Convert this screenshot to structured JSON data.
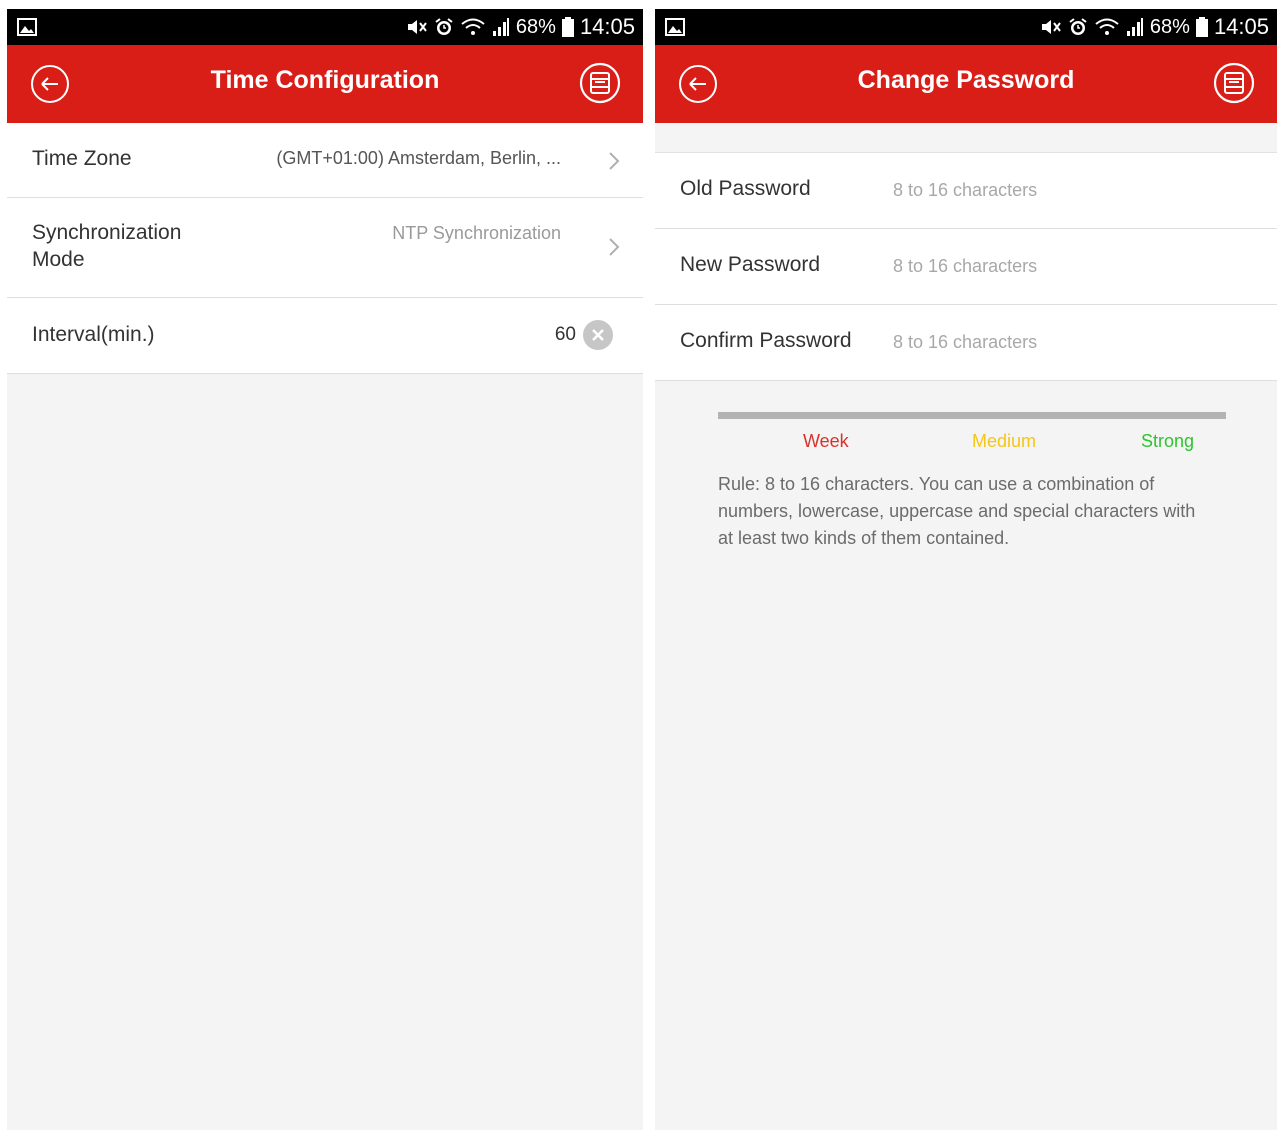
{
  "status_bar": {
    "battery": "68%",
    "time": "14:05"
  },
  "time_config": {
    "title": "Time Configuration",
    "rows": [
      {
        "label": "Time Zone",
        "value": "(GMT+01:00) Amsterdam, Berlin, ..."
      },
      {
        "label": "Synchronization Mode",
        "value": "NTP Synchronization"
      },
      {
        "label": "Interval(min.)",
        "value": "60"
      }
    ]
  },
  "change_password": {
    "title": "Change Password",
    "fields": [
      {
        "label": "Old Password",
        "placeholder": "8 to 16 characters"
      },
      {
        "label": "New Password",
        "placeholder": "8 to 16 characters"
      },
      {
        "label": "Confirm Password",
        "placeholder": "8 to 16 characters"
      }
    ],
    "strength": {
      "week": "Week",
      "medium": "Medium",
      "strong": "Strong",
      "colors": {
        "week": "#d9312b",
        "medium": "#f5c518",
        "strong": "#2ec42e"
      }
    },
    "rule": "Rule: 8 to 16 characters. You can use a combination of numbers, lowercase, uppercase and special characters with at least two kinds of them contained."
  },
  "icons": [
    "gallery-icon",
    "mute-icon",
    "alarm-icon",
    "wifi-icon",
    "signal-icon",
    "battery-icon",
    "back-arrow-icon",
    "save-icon",
    "chevron-right-icon",
    "clear-icon"
  ]
}
